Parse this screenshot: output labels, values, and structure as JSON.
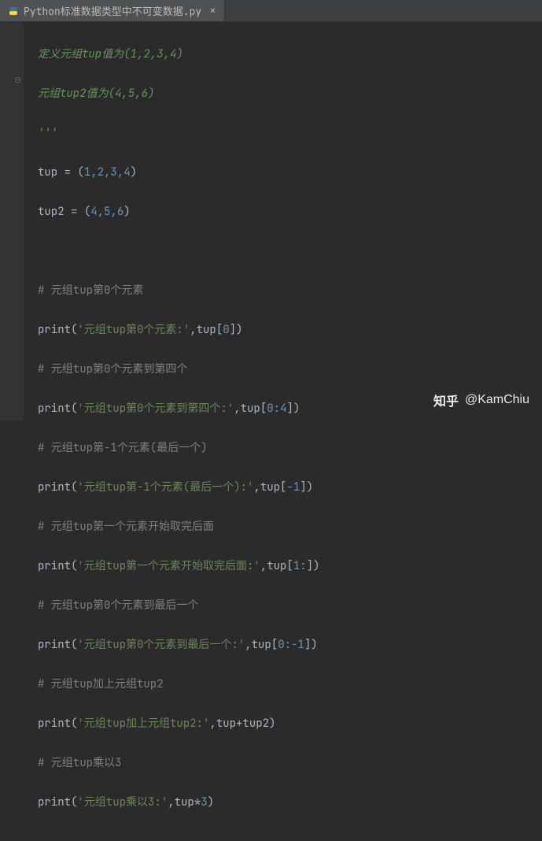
{
  "tab": {
    "filename": "Python标准数据类型中不可变数据.py",
    "close_symbol": "×"
  },
  "code": {
    "doc1": "定义元组tup值为(1,2,3,4)",
    "doc2": "元组tup2值为(4,5,6)",
    "docend": "'''",
    "assign1_var": "tup",
    "assign1_eq": " = ",
    "assign1_lp": "(",
    "assign1_vals": "1,2,3,4",
    "assign1_rp": ")",
    "assign2_var": "tup2",
    "assign2_eq": " = ",
    "assign2_lp": "(",
    "assign2_vals": "4,5,6",
    "assign2_rp": ")",
    "c1": "# 元组tup第0个元素",
    "p1_func": "print",
    "p1_lp": "(",
    "p1_str": "'元组tup第0个元素:'",
    "p1_comma": ",",
    "p1_expr_var": "tup",
    "p1_expr_lb": "[",
    "p1_expr_n": "0",
    "p1_expr_rb": "]",
    "p1_rp": ")",
    "c2": "# 元组tup第0个元素到第四个",
    "p2_str": "'元组tup第0个元素到第四个:'",
    "p2_expr_n": "0:4",
    "c3": "# 元组tup第-1个元素(最后一个)",
    "p3_str": "'元组tup第-1个元素(最后一个):'",
    "p3_expr_n": "-1",
    "c4": "# 元组tup第一个元素开始取完后面",
    "p4_str": "'元组tup第一个元素开始取完后面:'",
    "p4_expr_n": "1:",
    "c5": "# 元组tup第0个元素到最后一个",
    "p5_str": "'元组tup第0个元素到最后一个:'",
    "p5_expr_n": "0:-1",
    "c6": "# 元组tup加上元组tup2",
    "p6_str": "'元组tup加上元组tup2:'",
    "p6_expr_v1": "tup",
    "p6_expr_op": "+",
    "p6_expr_v2": "tup2",
    "c7": "# 元组tup乘以3",
    "p7_str": "'元组tup乘以3:'",
    "p7_expr_v": "tup",
    "p7_expr_op": "*",
    "p7_expr_n": "3"
  },
  "watermark": {
    "site": "知乎",
    "user": "@KamChiu"
  }
}
